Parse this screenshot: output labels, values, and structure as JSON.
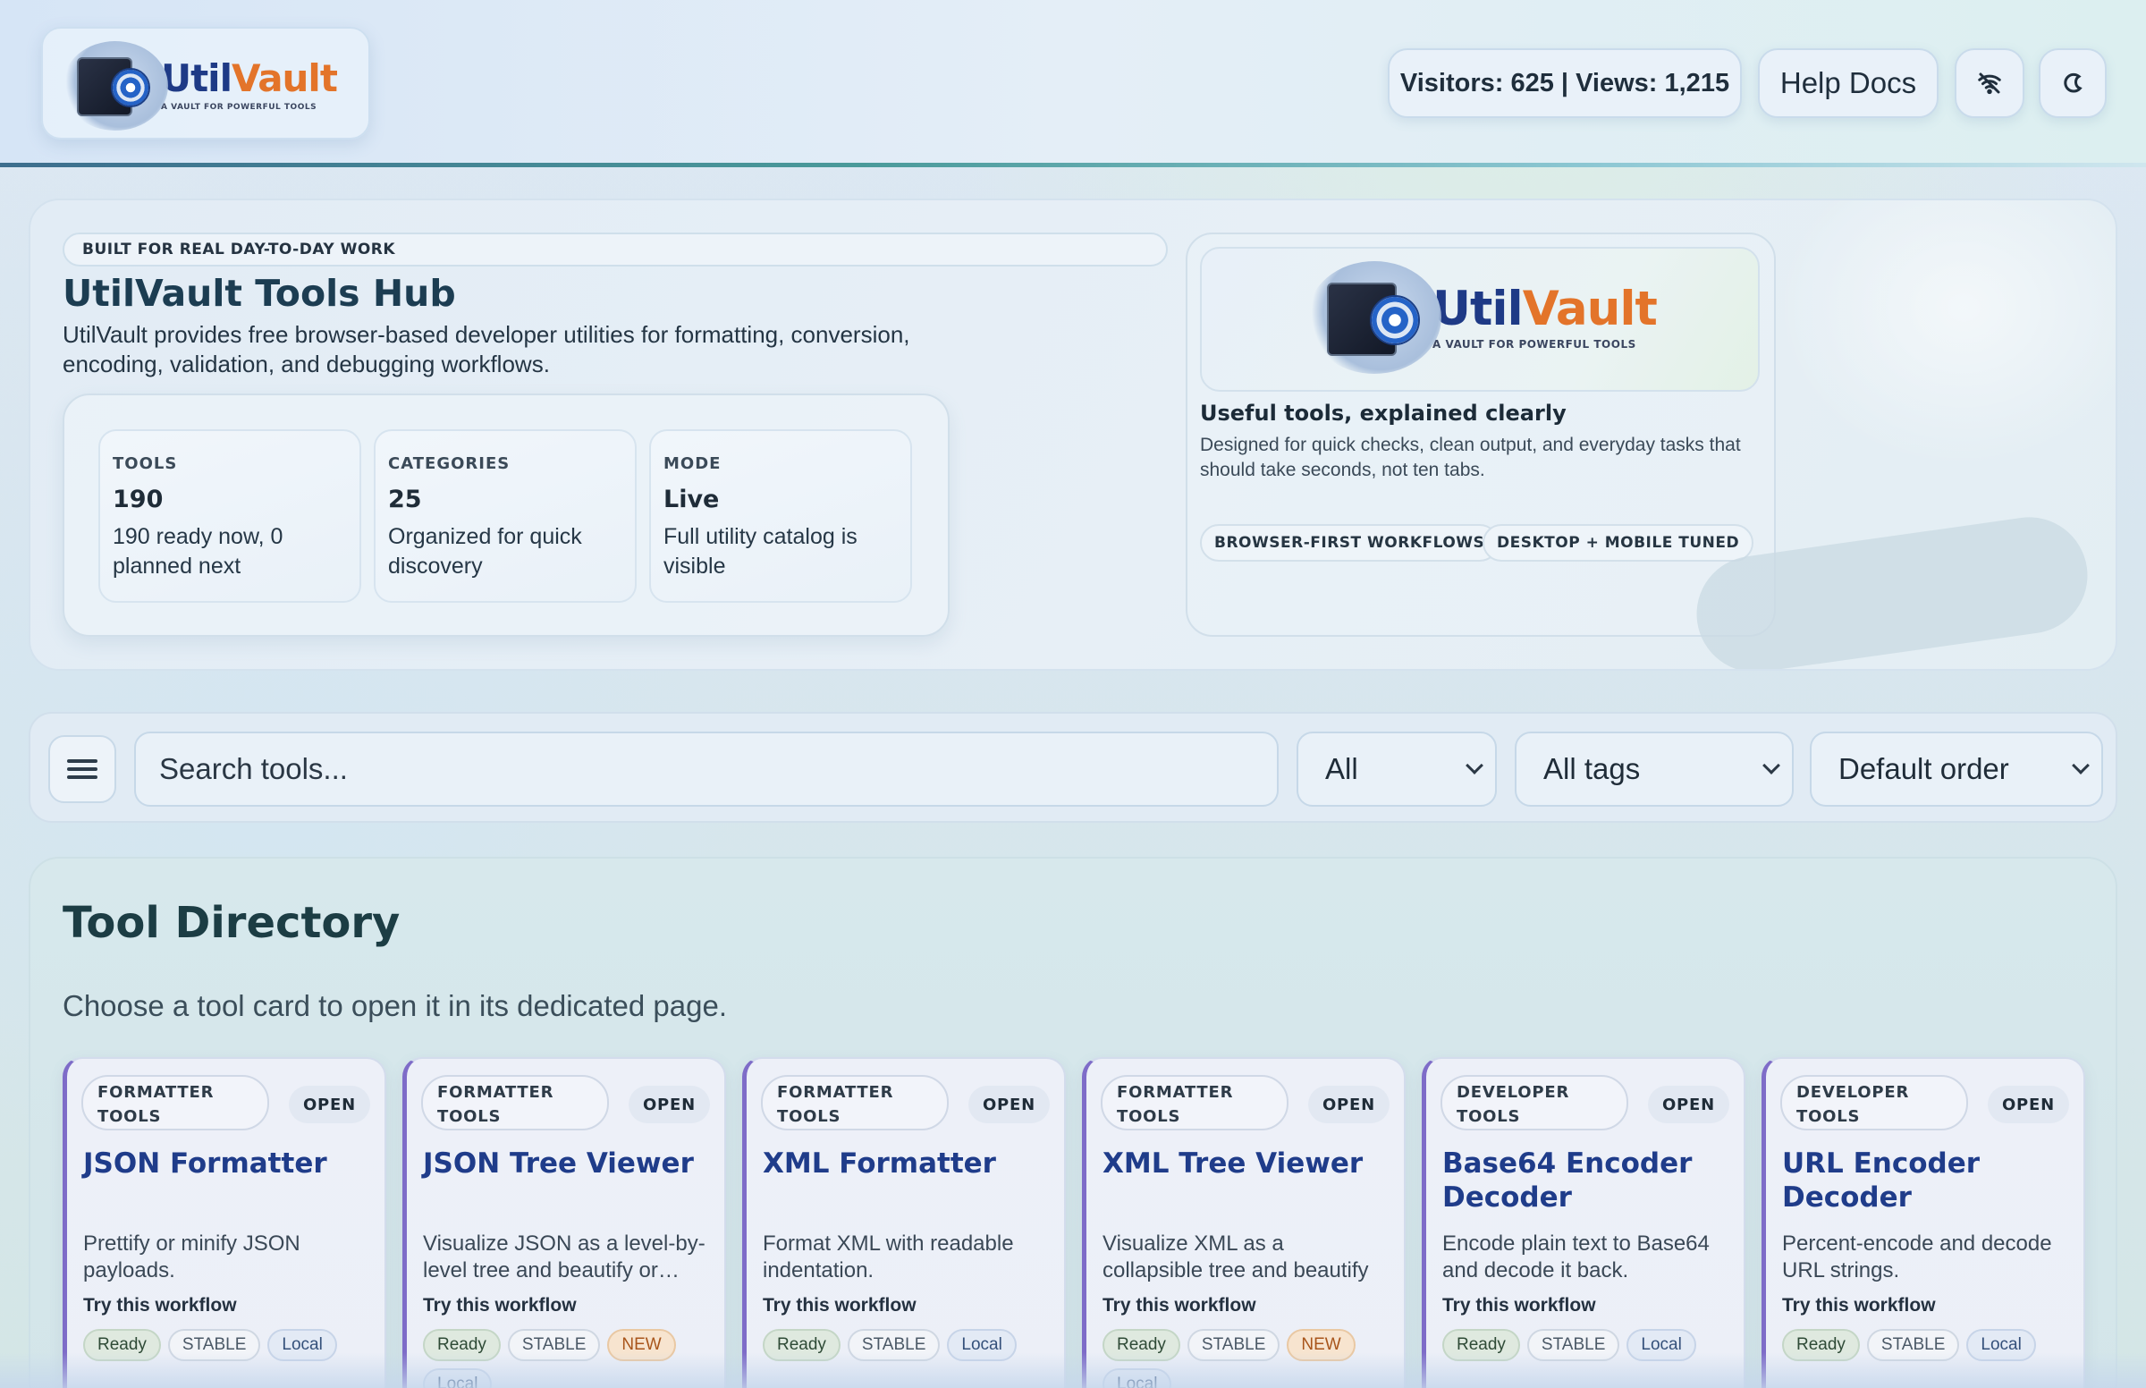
{
  "brand": {
    "name_part1": "Util",
    "name_part2": "Vault",
    "tagline": "A VAULT FOR POWERFUL TOOLS"
  },
  "header": {
    "stats_label": "Visitors: 625 | Views: 1,215",
    "help_label": "Help Docs",
    "wifi_icon": "wifi-off-icon",
    "theme_icon": "moon-icon"
  },
  "hero": {
    "badge": "BUILT FOR REAL DAY-TO-DAY WORK",
    "title": "UtilVault Tools Hub",
    "description": "UtilVault provides free browser-based developer utilities for formatting, conversion, encoding, validation, and debugging workflows.",
    "stats": [
      {
        "label": "TOOLS",
        "value": "190",
        "detail": "190 ready now, 0 planned next"
      },
      {
        "label": "CATEGORIES",
        "value": "25",
        "detail": "Organized for quick discovery"
      },
      {
        "label": "MODE",
        "value": "Live",
        "detail": "Full utility catalog is visible"
      }
    ],
    "card": {
      "heading": "Useful tools, explained clearly",
      "text": "Designed for quick checks, clean output, and everyday tasks that should take seconds, not ten tabs.",
      "chips": [
        "BROWSER-FIRST WORKFLOWS",
        "DESKTOP + MOBILE TUNED"
      ]
    }
  },
  "toolbar": {
    "menu_icon": "hamburger-menu-icon",
    "search_placeholder": "Search tools...",
    "category_filter": "All",
    "tag_filter": "All tags",
    "sort_order": "Default order"
  },
  "directory": {
    "title": "Tool Directory",
    "subtitle": "Choose a tool card to open it in its dedicated page.",
    "open_label": "OPEN",
    "workflow_label": "Try this workflow",
    "cards": [
      {
        "category_line1": "FORMATTER",
        "category_line2": "TOOLS",
        "name": "JSON Formatter",
        "description": "Prettify or minify JSON payloads.",
        "tags": [
          "Ready",
          "STABLE",
          "Local"
        ]
      },
      {
        "category_line1": "FORMATTER",
        "category_line2": "TOOLS",
        "name": "JSON Tree Viewer",
        "description": "Visualize JSON as a level-by-level tree and beautify or…",
        "tags": [
          "Ready",
          "STABLE",
          "NEW",
          "Local"
        ]
      },
      {
        "category_line1": "FORMATTER",
        "category_line2": "TOOLS",
        "name": "XML Formatter",
        "description": "Format XML with readable indentation.",
        "tags": [
          "Ready",
          "STABLE",
          "Local"
        ]
      },
      {
        "category_line1": "FORMATTER",
        "category_line2": "TOOLS",
        "name": "XML Tree Viewer",
        "description": "Visualize XML as a collapsible tree and beautify or minify…",
        "tags": [
          "Ready",
          "STABLE",
          "NEW",
          "Local"
        ]
      },
      {
        "category_line1": "DEVELOPER",
        "category_line2": "TOOLS",
        "name": "Base64 Encoder Decoder",
        "description": "Encode plain text to Base64 and decode it back.",
        "tags": [
          "Ready",
          "STABLE",
          "Local"
        ]
      },
      {
        "category_line1": "DEVELOPER",
        "category_line2": "TOOLS",
        "name": "URL Encoder Decoder",
        "description": "Percent-encode and decode URL strings.",
        "tags": [
          "Ready",
          "STABLE",
          "Local"
        ]
      }
    ]
  },
  "colors": {
    "brand_blue": "#1e3a86",
    "brand_orange": "#e3742a",
    "card_accent": "#7e6cc8",
    "tag_new": "#a8551b"
  }
}
